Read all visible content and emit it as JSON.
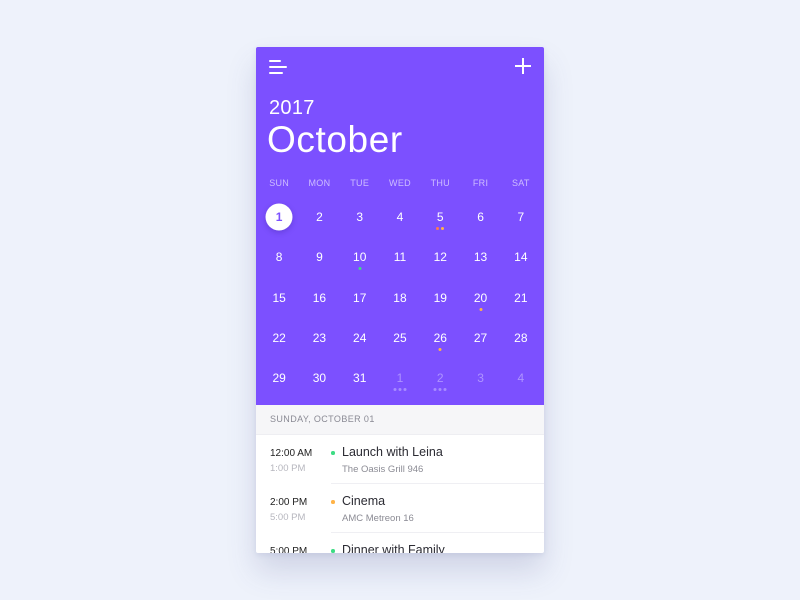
{
  "calendar": {
    "year": "2017",
    "month": "October",
    "weekdays": [
      "SUN",
      "MON",
      "TUE",
      "WED",
      "THU",
      "FRI",
      "SAT"
    ],
    "weeks": [
      [
        {
          "n": "1",
          "selected": true
        },
        {
          "n": "2"
        },
        {
          "n": "3"
        },
        {
          "n": "4"
        },
        {
          "n": "5",
          "dots": [
            "#ff7a4a",
            "#ffb347"
          ]
        },
        {
          "n": "6"
        },
        {
          "n": "7"
        }
      ],
      [
        {
          "n": "8"
        },
        {
          "n": "9"
        },
        {
          "n": "10",
          "dots": [
            "#3ddc84"
          ]
        },
        {
          "n": "11"
        },
        {
          "n": "12"
        },
        {
          "n": "13"
        },
        {
          "n": "14"
        }
      ],
      [
        {
          "n": "15"
        },
        {
          "n": "16"
        },
        {
          "n": "17"
        },
        {
          "n": "18"
        },
        {
          "n": "19"
        },
        {
          "n": "20",
          "dots": [
            "#ffb347"
          ]
        },
        {
          "n": "21"
        }
      ],
      [
        {
          "n": "22"
        },
        {
          "n": "23"
        },
        {
          "n": "24"
        },
        {
          "n": "25"
        },
        {
          "n": "26",
          "dots": [
            "#ffb347"
          ]
        },
        {
          "n": "27"
        },
        {
          "n": "28"
        }
      ],
      [
        {
          "n": "29"
        },
        {
          "n": "30"
        },
        {
          "n": "31"
        },
        {
          "n": "1",
          "muted": true,
          "dots": [
            "#a88bff",
            "#a88bff",
            "#a88bff"
          ]
        },
        {
          "n": "2",
          "muted": true,
          "dots": [
            "#a88bff",
            "#a88bff",
            "#a88bff"
          ]
        },
        {
          "n": "3",
          "muted": true
        },
        {
          "n": "4",
          "muted": true
        }
      ]
    ]
  },
  "selected_date_label": "SUNDAY, OCTOBER 01",
  "events": [
    {
      "start": "12:00 AM",
      "end": "1:00 PM",
      "title": "Launch with Leina",
      "place": "The Oasis Grill 946",
      "color": "#3ddc84"
    },
    {
      "start": "2:00 PM",
      "end": "5:00 PM",
      "title": "Cinema",
      "place": "AMC Metreon 16",
      "color": "#ffb347"
    },
    {
      "start": "5:00 PM",
      "end": "",
      "title": "Dinner with Family",
      "place": "",
      "color": "#3ddc84"
    }
  ],
  "colors": {
    "accent": "#7c50ff",
    "background": "#eef2fb"
  },
  "icons": {
    "menu": "menu-icon",
    "add": "plus-icon"
  }
}
